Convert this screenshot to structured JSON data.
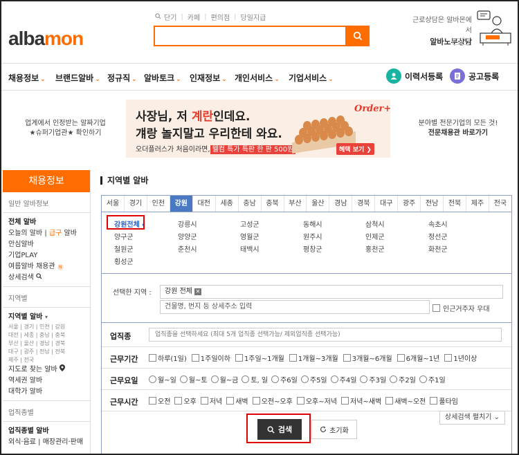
{
  "header": {
    "logo_main": "alba",
    "logo_accent": "mon",
    "top_links": [
      "단기",
      "카페",
      "편의점",
      "당일지급"
    ],
    "consult_line1": "근로상담은 알바몬에서",
    "consult_line2": "알바노무상담"
  },
  "nav": {
    "items": [
      "채용정보",
      "브랜드알바",
      "정규직",
      "알바토크",
      "인재정보",
      "개인서비스",
      "기업서비스"
    ],
    "resume_label": "이력서등록",
    "post_label": "공고등록"
  },
  "ads": {
    "left_line1": "업계에서 인정받는 알짜기업",
    "left_line2": "★슈퍼기업관★ 확인하기",
    "right_line1": "분야별 전문기업의 모든 것!",
    "right_line2": "전문채용관 바로가기",
    "banner_line1_pre": "사장님, 저 ",
    "banner_line1_red": "계란",
    "banner_line1_post": "인데요.",
    "banner_line2": "걔랑 놀지말고 우리한테 와요.",
    "banner_line3_pre": "오더플러스가 처음이라면,",
    "banner_line3_hl": "웰컴 특가 특판 한 판 500원",
    "banner_brand": "Order+",
    "banner_cta": "혜택 보기 ❯"
  },
  "sidebar": {
    "header": "채용정보",
    "section1": "일반 알바정보",
    "s1_items": [
      "전체 알바",
      "오늘의 알바",
      "급구",
      "알바",
      "안심알바",
      "기업PLAY",
      "여름알바 채용관",
      "상세검색"
    ],
    "section2": "지역별",
    "s2_title": "지역별 알바",
    "s2_regions_1": "서울 | 경기 | 인천 | 강원",
    "s2_regions_2": "대전 | 세종 | 충남 | 충북",
    "s2_regions_3": "부산 | 울산 | 경남 | 경북",
    "s2_regions_4": "대구 | 광주 | 전남 | 전북",
    "s2_regions_5": "제주 | 전국",
    "s2_map": "지도로 찾는 알바",
    "s2_station": "역세권 알바",
    "s2_campus": "대학가 알바",
    "section3": "업직종별",
    "s3_title": "업직종별 알바",
    "s3_sub": "외식·음료 | 매장관리·판매"
  },
  "main": {
    "title": "지역별 알바",
    "tabs": [
      "서울",
      "경기",
      "인천",
      "강원",
      "대전",
      "세종",
      "충남",
      "충북",
      "부산",
      "울산",
      "경남",
      "경북",
      "대구",
      "광주",
      "전남",
      "전북",
      "제주",
      "전국"
    ],
    "active_tab": "강원",
    "subregions": [
      "강원전체",
      "강릉시",
      "고성군",
      "동해시",
      "삼척시",
      "속초시",
      "양구군",
      "양양군",
      "영월군",
      "원주시",
      "인제군",
      "정선군",
      "철원군",
      "춘천시",
      "태백시",
      "평창군",
      "홍천군",
      "화천군",
      "횡성군"
    ],
    "selected_label": "선택한 지역 :",
    "selected_value": "강원 전체",
    "addr_placeholder": "건물명, 번지 등 상세주소 입력",
    "nearby_label": "인근거주자 우대"
  },
  "filters": {
    "job_label": "업직종",
    "job_placeholder": "업직종을 선택하세요 (최대 5개 업직종 선택가능/ 제외업직종 선택가능)",
    "period_label": "근무기간",
    "period_options": [
      "하루(1일)",
      "1주일이하",
      "1주일~1개월",
      "1개월~3개월",
      "3개월~6개월",
      "6개월~1년",
      "1년이상"
    ],
    "days_label": "근무요일",
    "days_options": [
      "월~일",
      "월~토",
      "월~금",
      "토, 일",
      "주6일",
      "주5일",
      "주4일",
      "주3일",
      "주2일",
      "주1일"
    ],
    "time_label": "근무시간",
    "time_options": [
      "오전",
      "오후",
      "저녁",
      "새벽",
      "오전~오후",
      "오후~저녁",
      "저녁~새벽",
      "새벽~오전",
      "풀타임"
    ],
    "more_label": "상세검색 펼치기 ⌄",
    "search_label": "검색",
    "reset_label": "초기화"
  },
  "colors": {
    "brand": "#ff6c00",
    "active_tab": "#4a79c2",
    "highlight_box": "#e00000"
  }
}
